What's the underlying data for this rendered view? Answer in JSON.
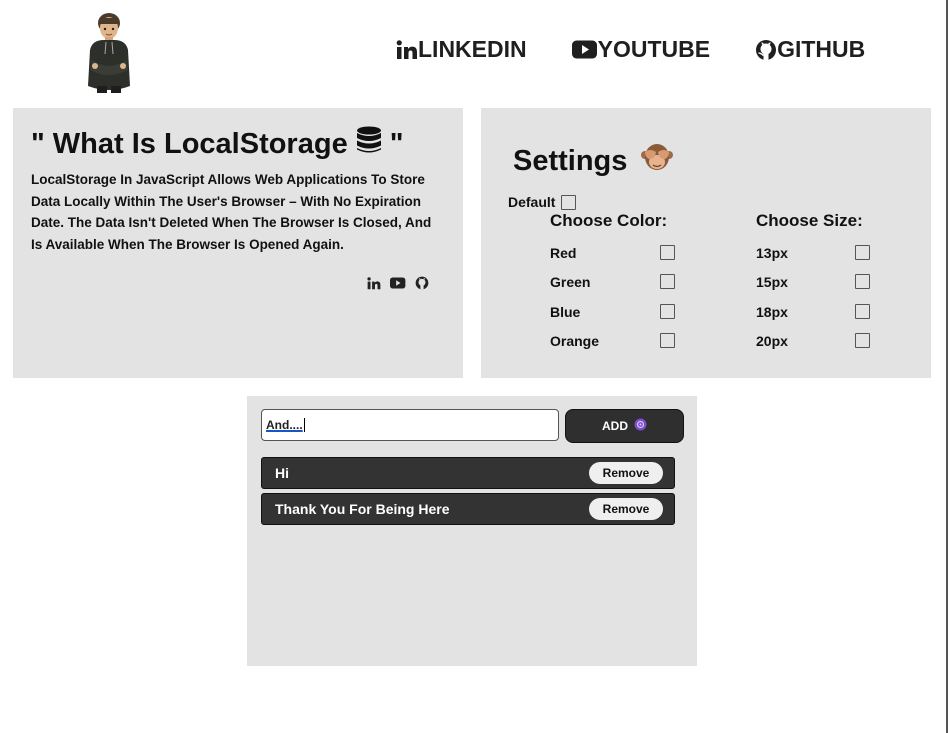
{
  "header": {
    "avatar_icon": "person-avatar",
    "nav": [
      {
        "label": "LINKEDIN",
        "icon": "linkedin-icon"
      },
      {
        "label": "YOUTUBE",
        "icon": "youtube-icon"
      },
      {
        "label": "GITHUB",
        "icon": "github-icon"
      }
    ]
  },
  "intro": {
    "title_prefix": "\" What Is LocalStorage",
    "title_suffix": "\"",
    "title_icon": "database-icon",
    "description": "LocalStorage In JavaScript Allows Web Applications To Store Data Locally Within The User's Browser – With No Expiration Date. The Data Isn't Deleted When The Browser Is Closed, And Is Available When The Browser Is Opened Again.",
    "social_icons": [
      "linkedin-icon",
      "youtube-icon",
      "github-icon"
    ]
  },
  "settings": {
    "title": "Settings",
    "title_icon": "see-no-evil-monkey-icon",
    "default_label": "Default",
    "color_heading": "Choose Color:",
    "size_heading": "Choose Size:",
    "colors": [
      {
        "label": "Red",
        "checked": false
      },
      {
        "label": "Green",
        "checked": false
      },
      {
        "label": "Blue",
        "checked": false
      },
      {
        "label": "Orange",
        "checked": false
      }
    ],
    "sizes": [
      {
        "label": "13px",
        "checked": false
      },
      {
        "label": "15px",
        "checked": false
      },
      {
        "label": "18px",
        "checked": false
      },
      {
        "label": "20px",
        "checked": false
      }
    ]
  },
  "todo": {
    "input_value": "And....",
    "add_label": "ADD",
    "add_icon": "purple-circle-icon",
    "items": [
      {
        "text": "Hi",
        "remove_label": "Remove"
      },
      {
        "text": "Thank You For Being Here",
        "remove_label": "Remove"
      }
    ]
  },
  "colors": {
    "panel_bg": "#e3e3e3",
    "dark": "#333333",
    "accent_purple": "#7b4fc9"
  }
}
